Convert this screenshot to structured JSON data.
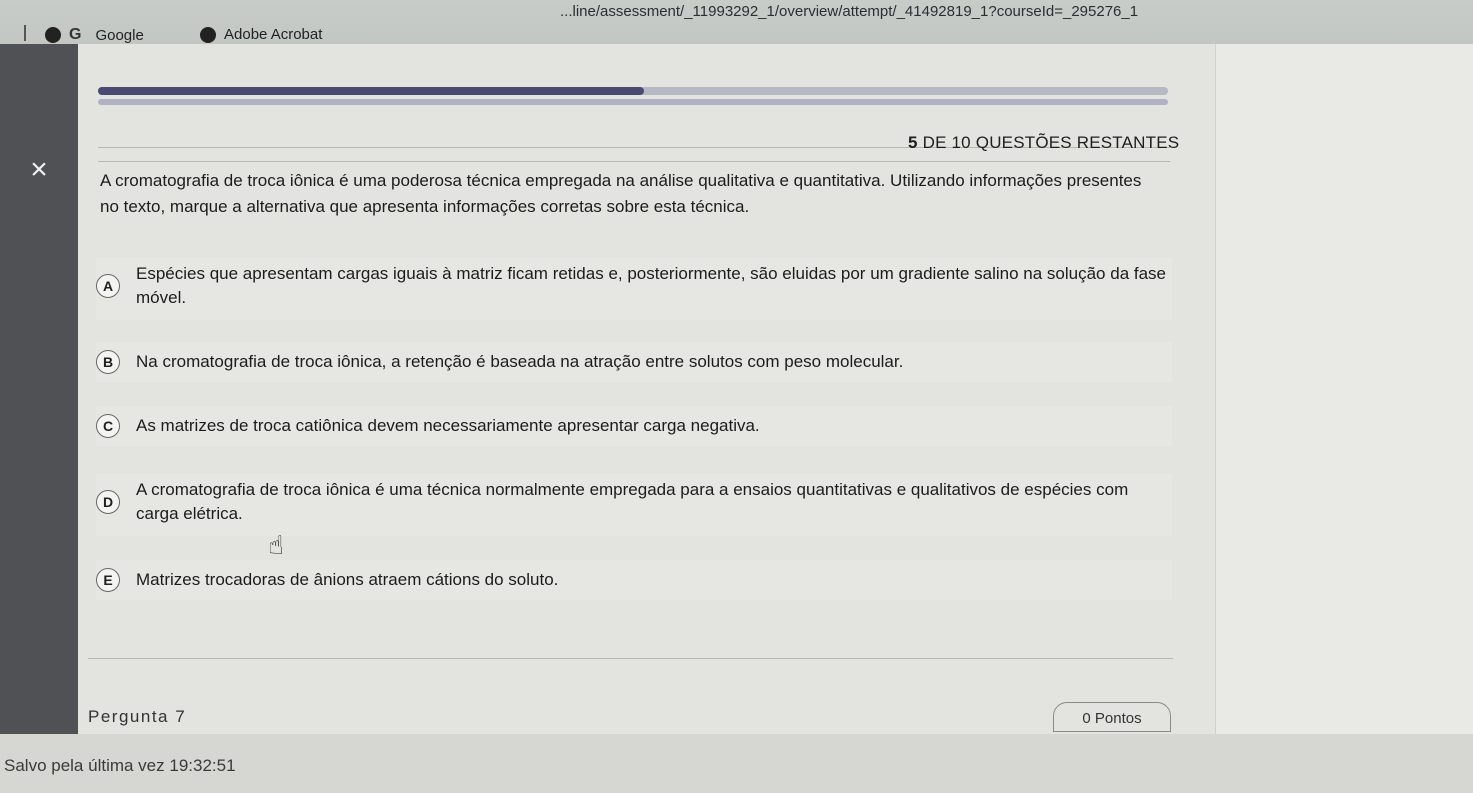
{
  "browser": {
    "url": "...line/assessment/_11993292_1/overview/attempt/_41492819_1?courseId=_295276_1",
    "bookmarks": [
      {
        "label": "Google",
        "icon": "google-g-icon"
      },
      {
        "label": "Adobe Acrobat",
        "icon": "acrobat-icon"
      }
    ]
  },
  "quiz": {
    "close_icon": "×",
    "progress_fraction": 0.51,
    "remaining_number": "5",
    "remaining_text": "DE 10 QUESTÕES RESTANTES",
    "question": "A cromatografia de troca iônica é uma poderosa técnica empregada na análise qualitativa e quantitativa. Utilizando informações presentes no texto, marque a alternativa que apresenta informações corretas sobre esta técnica.",
    "options": [
      {
        "letter": "A",
        "text": "Espécies que apresentam cargas iguais à matriz ficam retidas e, posteriormente, são eluidas por um gradiente salino na solução da fase móvel."
      },
      {
        "letter": "B",
        "text": "Na cromatografia de troca iônica, a retenção é baseada na atração entre solutos com peso molecular."
      },
      {
        "letter": "C",
        "text": "As matrizes de troca catiônica devem necessariamente apresentar carga negativa."
      },
      {
        "letter": "D",
        "text": "A cromatografia de troca iônica é uma técnica normalmente empregada para a ensaios quantitativas e qualitativos de espécies com carga elétrica."
      },
      {
        "letter": "E",
        "text": "Matrizes trocadoras de ânions atraem cátions do soluto."
      }
    ],
    "next_question_label": "Pergunta 7",
    "points_label": "0 Pontos"
  },
  "status": {
    "saved_text": "Salvo pela última vez 19:32:51"
  },
  "colors": {
    "progress": "#4b4872",
    "sidepanel": "#4f5154"
  }
}
